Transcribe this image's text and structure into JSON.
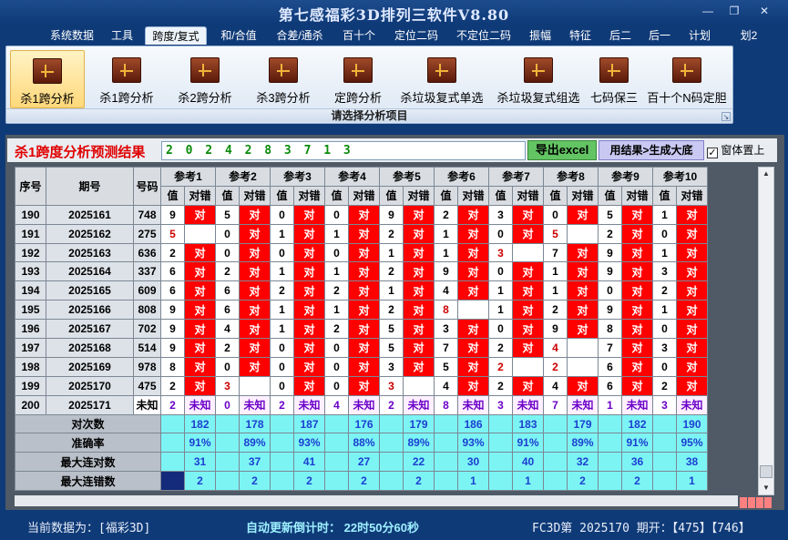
{
  "window": {
    "title": "第七感福彩3D排列三软件V8.80",
    "side_label": "划2"
  },
  "menu": [
    {
      "label": "系统数据"
    },
    {
      "label": "工具"
    },
    {
      "label": "跨度/复式",
      "active": true
    },
    {
      "label": "和/合值"
    },
    {
      "label": "合差/通杀"
    },
    {
      "label": "百十个"
    },
    {
      "label": "定位二码"
    },
    {
      "label": "不定位二码"
    },
    {
      "label": "振幅"
    },
    {
      "label": "特征"
    },
    {
      "label": "后二"
    },
    {
      "label": "后一"
    },
    {
      "label": "计划"
    }
  ],
  "ribbon": {
    "buttons": [
      {
        "label": "杀1跨分析",
        "active": true
      },
      {
        "label": "杀1跨分析"
      },
      {
        "label": "杀2跨分析"
      },
      {
        "label": "杀3跨分析"
      },
      {
        "label": "定跨分析"
      },
      {
        "label": "杀垃圾复式单选"
      },
      {
        "label": "杀垃圾复式组选"
      },
      {
        "label": "七码保三"
      },
      {
        "label": "百十个N码定胆"
      }
    ],
    "caption": "请选择分析项目"
  },
  "result": {
    "title": "杀1跨度分析预测结果",
    "numbers": "2 0 2 4 2 8 3 7 1 3",
    "export_label": "导出excel",
    "generate_label": "用结果>生成大底",
    "on_top_label": "窗体置上",
    "on_top_checked": "✓"
  },
  "table": {
    "headers": {
      "seq": "序号",
      "issue": "期号",
      "code": "号码",
      "value": "值",
      "result": "对错"
    },
    "refs": [
      "参考1",
      "参考2",
      "参考3",
      "参考4",
      "参考5",
      "参考6",
      "参考7",
      "参考8",
      "参考9",
      "参考10"
    ],
    "correct_mark": "对",
    "rows": [
      {
        "seq": "190",
        "issue": "2025161",
        "code": "748",
        "vals": [
          "9",
          "5",
          "0",
          "0",
          "9",
          "2",
          "3",
          "0",
          "5",
          "1"
        ],
        "res": [
          1,
          1,
          1,
          1,
          1,
          1,
          1,
          1,
          1,
          1
        ],
        "hl": [
          0,
          0,
          0,
          0,
          0,
          0,
          0,
          0,
          0,
          0
        ]
      },
      {
        "seq": "191",
        "issue": "2025162",
        "code": "275",
        "vals": [
          "5",
          "0",
          "1",
          "1",
          "2",
          "1",
          "0",
          "5",
          "2",
          "0"
        ],
        "res": [
          0,
          1,
          1,
          1,
          1,
          1,
          1,
          0,
          1,
          1
        ],
        "hl": [
          1,
          0,
          0,
          0,
          0,
          0,
          0,
          1,
          0,
          0
        ]
      },
      {
        "seq": "192",
        "issue": "2025163",
        "code": "636",
        "vals": [
          "2",
          "0",
          "0",
          "0",
          "1",
          "1",
          "3",
          "7",
          "9",
          "1"
        ],
        "res": [
          1,
          1,
          1,
          1,
          1,
          1,
          0,
          1,
          1,
          1
        ],
        "hl": [
          0,
          0,
          0,
          0,
          0,
          0,
          1,
          0,
          0,
          0
        ]
      },
      {
        "seq": "193",
        "issue": "2025164",
        "code": "337",
        "vals": [
          "6",
          "2",
          "1",
          "1",
          "2",
          "9",
          "0",
          "1",
          "9",
          "3"
        ],
        "res": [
          1,
          1,
          1,
          1,
          1,
          1,
          1,
          1,
          1,
          1
        ],
        "hl": [
          0,
          0,
          0,
          0,
          0,
          0,
          0,
          0,
          0,
          0
        ]
      },
      {
        "seq": "194",
        "issue": "2025165",
        "code": "609",
        "vals": [
          "6",
          "6",
          "2",
          "2",
          "1",
          "4",
          "1",
          "1",
          "0",
          "2"
        ],
        "res": [
          1,
          1,
          1,
          1,
          1,
          1,
          1,
          1,
          1,
          1
        ],
        "hl": [
          0,
          0,
          0,
          0,
          0,
          0,
          0,
          0,
          0,
          0
        ]
      },
      {
        "seq": "195",
        "issue": "2025166",
        "code": "808",
        "vals": [
          "9",
          "6",
          "1",
          "1",
          "2",
          "8",
          "1",
          "2",
          "9",
          "1"
        ],
        "res": [
          1,
          1,
          1,
          1,
          1,
          0,
          1,
          1,
          1,
          1
        ],
        "hl": [
          0,
          0,
          0,
          0,
          0,
          1,
          0,
          0,
          0,
          0
        ]
      },
      {
        "seq": "196",
        "issue": "2025167",
        "code": "702",
        "vals": [
          "9",
          "4",
          "1",
          "2",
          "5",
          "3",
          "0",
          "9",
          "8",
          "0"
        ],
        "res": [
          1,
          1,
          1,
          1,
          1,
          1,
          1,
          1,
          1,
          1
        ],
        "hl": [
          0,
          0,
          0,
          0,
          0,
          0,
          0,
          0,
          0,
          0
        ]
      },
      {
        "seq": "197",
        "issue": "2025168",
        "code": "514",
        "vals": [
          "9",
          "2",
          "0",
          "0",
          "5",
          "7",
          "2",
          "4",
          "7",
          "3"
        ],
        "res": [
          1,
          1,
          1,
          1,
          1,
          1,
          1,
          0,
          1,
          1
        ],
        "hl": [
          0,
          0,
          0,
          0,
          0,
          0,
          0,
          1,
          0,
          0
        ]
      },
      {
        "seq": "198",
        "issue": "2025169",
        "code": "978",
        "vals": [
          "8",
          "0",
          "0",
          "0",
          "3",
          "5",
          "2",
          "2",
          "6",
          "0"
        ],
        "res": [
          1,
          1,
          1,
          1,
          1,
          1,
          0,
          0,
          1,
          1
        ],
        "hl": [
          0,
          0,
          0,
          0,
          0,
          0,
          1,
          1,
          0,
          0
        ]
      },
      {
        "seq": "199",
        "issue": "2025170",
        "code": "475",
        "vals": [
          "2",
          "3",
          "0",
          "0",
          "3",
          "4",
          "2",
          "4",
          "6",
          "2"
        ],
        "res": [
          1,
          0,
          1,
          1,
          0,
          1,
          1,
          1,
          1,
          1
        ],
        "hl": [
          0,
          1,
          0,
          0,
          1,
          0,
          0,
          0,
          0,
          0
        ]
      }
    ],
    "unknown_row": {
      "seq": "200",
      "issue": "2025171",
      "code": "未知",
      "mark": "未知",
      "vals": [
        "2",
        "0",
        "2",
        "4",
        "2",
        "8",
        "3",
        "7",
        "1",
        "3"
      ]
    },
    "stats": [
      {
        "label": "对次数",
        "vals": [
          "182",
          "178",
          "187",
          "176",
          "179",
          "186",
          "183",
          "179",
          "182",
          "190"
        ]
      },
      {
        "label": "准确率",
        "vals": [
          "91%",
          "89%",
          "93%",
          "88%",
          "89%",
          "93%",
          "91%",
          "89%",
          "91%",
          "95%"
        ]
      },
      {
        "label": "最大连对数",
        "vals": [
          "31",
          "37",
          "41",
          "27",
          "22",
          "30",
          "40",
          "32",
          "36",
          "38"
        ]
      },
      {
        "label": "最大连错数",
        "vals": [
          "2",
          "2",
          "2",
          "2",
          "2",
          "1",
          "1",
          "2",
          "2",
          "1"
        ]
      }
    ]
  },
  "status": {
    "current_data": "当前数据为：[福彩3D]",
    "countdown": "自动更新倒计时：  22时50分60秒",
    "info": "FC3D第 2025170 期开：【475】【746】"
  }
}
